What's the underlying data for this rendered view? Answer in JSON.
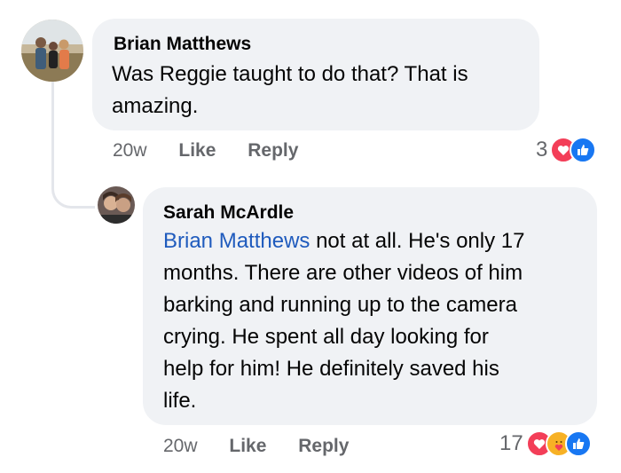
{
  "comments": [
    {
      "author": "Brian Matthews",
      "text_lines": [
        "Was Reggie taught to do that? That is",
        "amazing."
      ],
      "time": "20w",
      "like_label": "Like",
      "reply_label": "Reply",
      "reaction_count": "3",
      "reactions": [
        "heart-icon",
        "like-thumb-icon"
      ]
    },
    {
      "author": "Sarah McArdle",
      "mention": "Brian Matthews",
      "text_lines": [
        " not at all. He's only 17",
        "months. There are other videos of him",
        "barking and running up to the camera",
        "crying. He spent all day looking for",
        "help for him! He definitely saved his",
        "life."
      ],
      "time": "20w",
      "like_label": "Like",
      "reply_label": "Reply",
      "reaction_count": "17",
      "reactions": [
        "heart-icon",
        "care-icon",
        "like-thumb-icon"
      ]
    }
  ],
  "colors": {
    "bubble": "#f0f2f5",
    "mention": "#1f5bbd",
    "meta": "#65676b",
    "heart": "#f33e58",
    "like": "#1877f2",
    "care": "#f7b125"
  }
}
